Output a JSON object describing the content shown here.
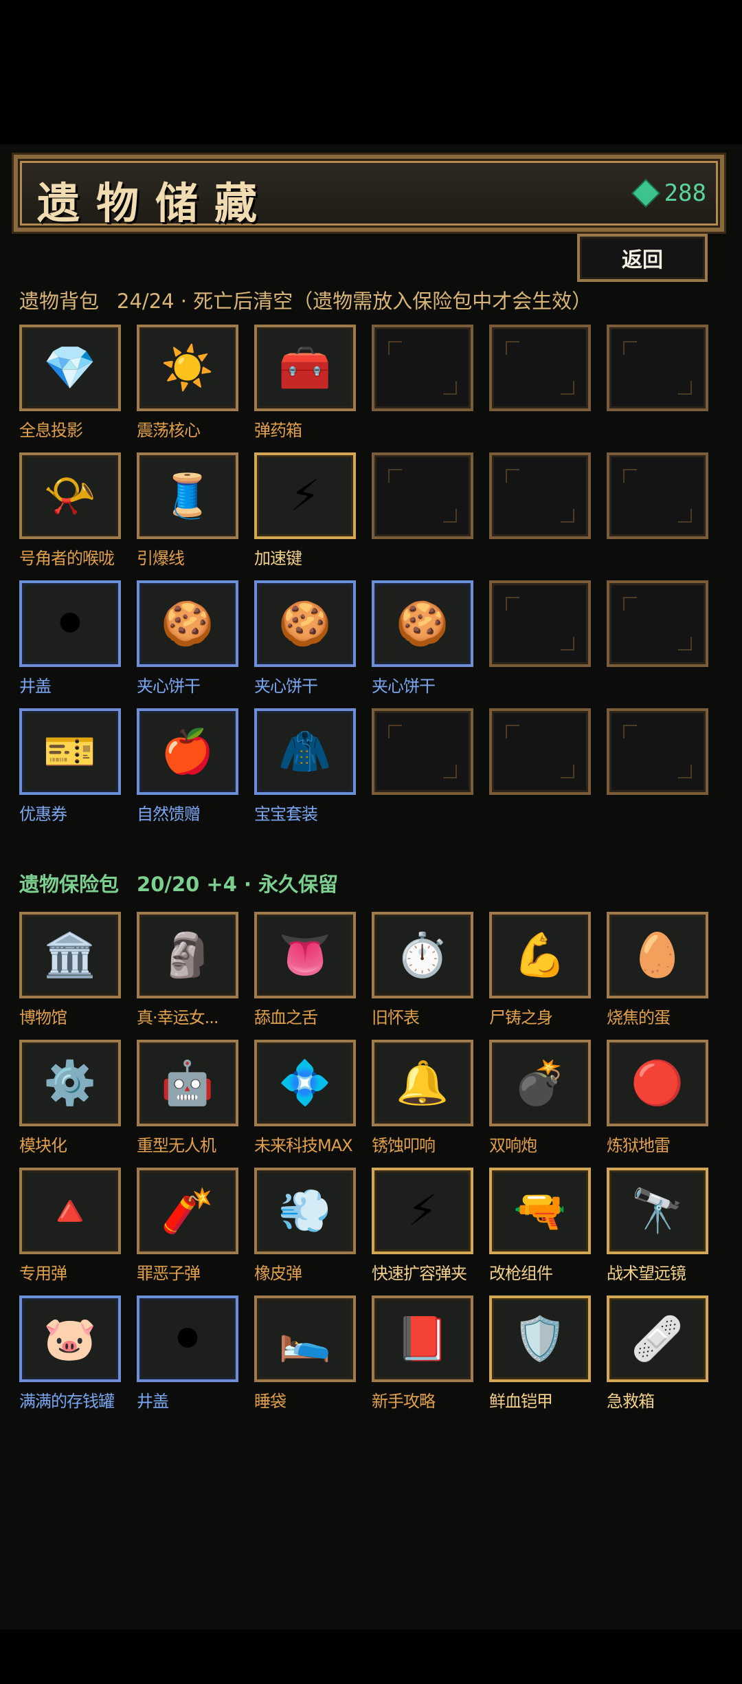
{
  "title": "遗物储藏",
  "gems": {
    "icon": "green-gem-icon",
    "count": "288",
    "color": "#3cc48c"
  },
  "back_label": "返回",
  "backpack": {
    "name": "遗物背包",
    "info": "24/24 · 死亡后清空（遗物需放入保险包中才会生效）",
    "rows": [
      [
        {
          "label": "全息投影",
          "rarity": "orange",
          "icon": "hologram-crystal-icon",
          "glyph": "💎"
        },
        {
          "label": "震荡核心",
          "rarity": "orange",
          "icon": "shock-core-icon",
          "glyph": "☀️"
        },
        {
          "label": "弹药箱",
          "rarity": "orange",
          "icon": "ammo-box-icon",
          "glyph": "🧰"
        },
        {
          "empty": true
        },
        {
          "empty": true
        },
        {
          "empty": true
        }
      ],
      [
        {
          "label": "号角者的喉咙",
          "rarity": "orange",
          "icon": "horn-throat-icon",
          "glyph": "📯"
        },
        {
          "label": "引爆线",
          "rarity": "orange",
          "icon": "detonator-wire-icon",
          "glyph": "🧵"
        },
        {
          "label": "加速键",
          "rarity": "gold",
          "icon": "speed-key-icon",
          "glyph": "⚡"
        },
        {
          "empty": true
        },
        {
          "empty": true
        },
        {
          "empty": true
        }
      ],
      [
        {
          "label": "井盖",
          "rarity": "blue",
          "icon": "manhole-cover-icon",
          "glyph": "⚫"
        },
        {
          "label": "夹心饼干",
          "rarity": "blue",
          "icon": "sandwich-cookie-icon",
          "glyph": "🍪"
        },
        {
          "label": "夹心饼干",
          "rarity": "blue",
          "icon": "sandwich-cookie-icon",
          "glyph": "🍪"
        },
        {
          "label": "夹心饼干",
          "rarity": "blue",
          "icon": "sandwich-cookie-icon",
          "glyph": "🍪"
        },
        {
          "empty": true
        },
        {
          "empty": true
        }
      ],
      [
        {
          "label": "优惠券",
          "rarity": "blue",
          "icon": "coupon-icon",
          "glyph": "🎫"
        },
        {
          "label": "自然馈赠",
          "rarity": "blue",
          "icon": "apple-icon",
          "glyph": "🍎"
        },
        {
          "label": "宝宝套装",
          "rarity": "blue",
          "icon": "baby-suit-icon",
          "glyph": "🧥"
        },
        {
          "empty": true
        },
        {
          "empty": true
        },
        {
          "empty": true
        }
      ]
    ]
  },
  "vault": {
    "name": "遗物保险包",
    "info": "20/20 +4 · 永久保留",
    "rows": [
      [
        {
          "label": "博物馆",
          "rarity": "orange",
          "icon": "museum-icon",
          "glyph": "🏛️"
        },
        {
          "label": "真·幸运女...",
          "rarity": "orange",
          "icon": "lucky-statue-icon",
          "glyph": "🗿"
        },
        {
          "label": "舔血之舌",
          "rarity": "orange",
          "icon": "tongue-icon",
          "glyph": "👅"
        },
        {
          "label": "旧怀表",
          "rarity": "orange",
          "icon": "pocket-watch-icon",
          "glyph": "⏱️"
        },
        {
          "label": "尸铸之身",
          "rarity": "orange",
          "icon": "corpse-body-icon",
          "glyph": "💪"
        },
        {
          "label": "烧焦的蛋",
          "rarity": "orange",
          "icon": "burnt-egg-icon",
          "glyph": "🥚"
        }
      ],
      [
        {
          "label": "模块化",
          "rarity": "orange",
          "icon": "module-icon",
          "glyph": "⚙️"
        },
        {
          "label": "重型无人机",
          "rarity": "orange",
          "icon": "heavy-drone-icon",
          "glyph": "🤖"
        },
        {
          "label": "未来科技MAX",
          "rarity": "orange",
          "icon": "future-tech-icon",
          "glyph": "💠"
        },
        {
          "label": "锈蚀叩响",
          "rarity": "orange",
          "icon": "rusty-knock-icon",
          "glyph": "🔔"
        },
        {
          "label": "双响炮",
          "rarity": "orange",
          "icon": "double-cannon-icon",
          "glyph": "💣"
        },
        {
          "label": "炼狱地雷",
          "rarity": "orange",
          "icon": "purgatory-mine-icon",
          "glyph": "🔴"
        }
      ],
      [
        {
          "label": "专用弹",
          "rarity": "orange",
          "icon": "special-bullet-icon",
          "glyph": "🔺"
        },
        {
          "label": "罪恶子弹",
          "rarity": "orange",
          "icon": "sin-bullet-icon",
          "glyph": "🧨"
        },
        {
          "label": "橡皮弹",
          "rarity": "orange",
          "icon": "rubber-bullet-icon",
          "glyph": "💨"
        },
        {
          "label": "快速扩容弹夹",
          "rarity": "gold",
          "icon": "fast-mag-icon",
          "glyph": "⚡"
        },
        {
          "label": "改枪组件",
          "rarity": "gold",
          "icon": "gun-parts-icon",
          "glyph": "🔫"
        },
        {
          "label": "战术望远镜",
          "rarity": "gold",
          "icon": "binoculars-icon",
          "glyph": "🔭"
        }
      ],
      [
        {
          "label": "满满的存钱罐",
          "rarity": "blue",
          "icon": "piggy-bank-icon",
          "glyph": "🐷"
        },
        {
          "label": "井盖",
          "rarity": "blue",
          "icon": "manhole-cover-icon",
          "glyph": "⚫"
        },
        {
          "label": "睡袋",
          "rarity": "orange",
          "icon": "sleeping-bag-icon",
          "glyph": "🛌"
        },
        {
          "label": "新手攻略",
          "rarity": "orange",
          "icon": "guide-book-icon",
          "glyph": "📕"
        },
        {
          "label": "鲜血铠甲",
          "rarity": "gold",
          "icon": "blood-armor-icon",
          "glyph": "🛡️"
        },
        {
          "label": "急救箱",
          "rarity": "gold",
          "icon": "first-aid-kit-icon",
          "glyph": "🩹"
        }
      ]
    ]
  }
}
